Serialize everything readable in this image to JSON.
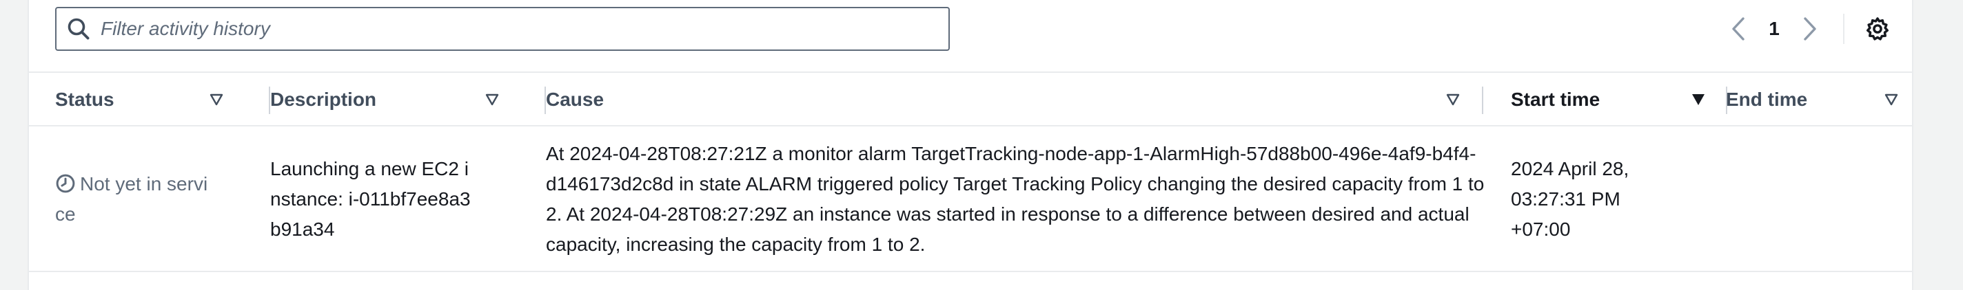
{
  "toolbar": {
    "filter_placeholder": "Filter activity history",
    "pagination": {
      "current_page": "1"
    }
  },
  "table": {
    "columns": [
      {
        "label": "Status"
      },
      {
        "label": "Description"
      },
      {
        "label": "Cause"
      },
      {
        "label": "Start time"
      },
      {
        "label": "End time"
      }
    ],
    "rows": [
      {
        "status": "Not yet in service",
        "description": "Launching a new EC2 instance: i-011bf7ee8a3b91a34",
        "cause": "At 2024-04-28T08:27:21Z a monitor alarm TargetTracking-node-app-1-AlarmHigh-57d88b00-496e-4af9-b4f4-d146173d2c8d in state ALARM triggered policy Target Tracking Policy changing the desired capacity from 1 to 2. At 2024-04-28T08:27:29Z an instance was started in response to a difference between desired and actual capacity, increasing the capacity from 1 to 2.",
        "start_time": "2024 April 28, 03:27:31 PM +07:00",
        "end_time": ""
      }
    ]
  },
  "colors": {
    "text": "#16191f",
    "muted": "#5f6b7a",
    "border": "#e9ebed",
    "background": "#f2f3f3"
  }
}
